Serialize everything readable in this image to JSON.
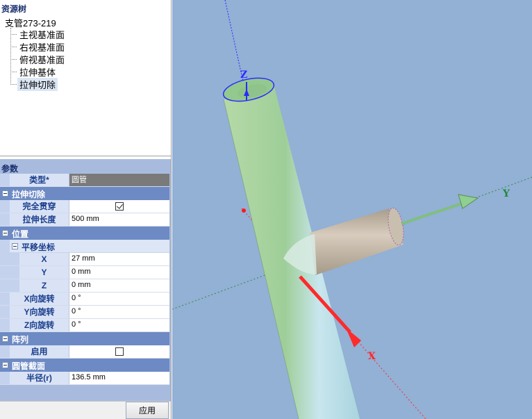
{
  "tree": {
    "title": "资源树",
    "root": "支管273-219",
    "items": [
      {
        "label": "主视基准面"
      },
      {
        "label": "右视基准面"
      },
      {
        "label": "俯视基准面"
      },
      {
        "label": "拉伸基体"
      },
      {
        "label": "拉伸切除",
        "selected": true
      }
    ]
  },
  "params": {
    "title": "参数",
    "type": {
      "label": "类型*",
      "value": "圆管"
    },
    "extrude_cut": {
      "label": "拉伸切除",
      "through_all": {
        "label": "完全贯穿",
        "checked": true
      },
      "length": {
        "label": "拉伸长度",
        "value": "500 mm"
      }
    },
    "position": {
      "label": "位置",
      "translate": {
        "label": "平移坐标",
        "x": {
          "label": "X",
          "value": "27 mm"
        },
        "y": {
          "label": "Y",
          "value": "0 mm"
        },
        "z": {
          "label": "Z",
          "value": "0 mm"
        }
      },
      "x_rot": {
        "label": "X向旋转",
        "value": "0 °"
      },
      "y_rot": {
        "label": "Y向旋转",
        "value": "0 °"
      },
      "z_rot": {
        "label": "Z向旋转",
        "value": "0 °"
      }
    },
    "array": {
      "label": "阵列",
      "enable": {
        "label": "启用",
        "checked": false
      }
    },
    "pipe_section": {
      "label": "圆管截面",
      "radius": {
        "label": "半径(r)",
        "value": "136.5 mm"
      }
    }
  },
  "apply_label": "应用",
  "viewport": {
    "axis_x": "X",
    "axis_y": "Y",
    "axis_z": "Z",
    "colors": {
      "background": "#93b0d5",
      "pipe": "#a8d8b8",
      "branch": "#bdb1a0",
      "x_axis": "#ff2a2a",
      "y_axis": "#7fbf7f",
      "z_axis": "#2a2aff"
    }
  }
}
